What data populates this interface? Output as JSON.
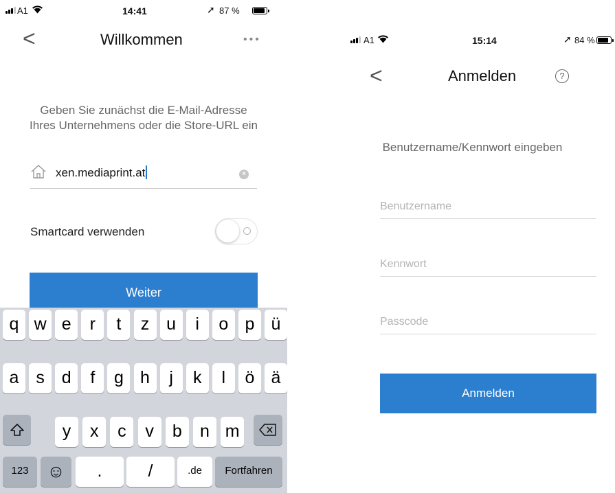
{
  "left": {
    "status": {
      "carrier": "A1",
      "time": "14:41",
      "battery": "87 %",
      "battery_level": 0.87
    },
    "nav": {
      "back": "<",
      "title": "Willkommen",
      "more": "•••"
    },
    "instruction_line1": "Geben Sie zunächst die E-Mail-Adresse",
    "instruction_line2": "Ihres Unternehmens oder die Store-URL ein",
    "url_value": "xen.mediaprint.at",
    "smartcard_label": "Smartcard verwenden",
    "smartcard_on": false,
    "continue_label": "Weiter",
    "keyboard": {
      "row1": [
        "q",
        "w",
        "e",
        "r",
        "t",
        "z",
        "u",
        "i",
        "o",
        "p",
        "ü"
      ],
      "row2": [
        "a",
        "s",
        "d",
        "f",
        "g",
        "h",
        "j",
        "k",
        "l",
        "ö",
        "ä"
      ],
      "row3": [
        "y",
        "x",
        "c",
        "v",
        "b",
        "n",
        "m"
      ],
      "numbers_key": "123",
      "emoji_key": "☺",
      "period_key": ".",
      "slash_key": "/",
      "de_key": ".de",
      "return_key": "Fortfahren"
    }
  },
  "right": {
    "status": {
      "carrier": "A1",
      "time": "15:14",
      "battery": "84 %",
      "battery_level": 0.84
    },
    "nav": {
      "back": "<",
      "title": "Anmelden",
      "help": "?"
    },
    "instruction": "Benutzername/Kennwort eingeben",
    "username_placeholder": "Benutzername",
    "password_placeholder": "Kennwort",
    "passcode_placeholder": "Passcode",
    "login_label": "Anmelden"
  },
  "colors": {
    "accent": "#2c7fce",
    "keyboard_bg": "#d2d5db"
  },
  "icons": [
    "signal-icon",
    "wifi-icon",
    "location-arrow-icon",
    "battery-icon",
    "house-icon",
    "clear-icon",
    "shift-icon",
    "backspace-icon",
    "emoji-icon",
    "help-icon"
  ]
}
